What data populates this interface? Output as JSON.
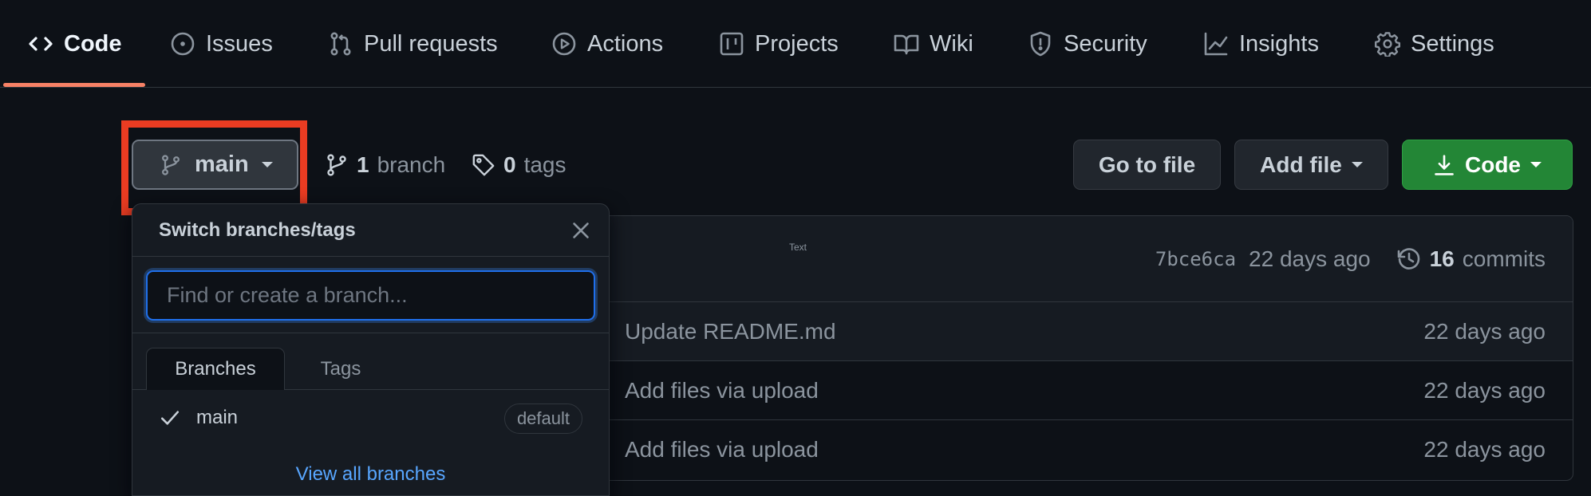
{
  "nav": {
    "tabs": [
      {
        "label": "Code",
        "icon": "code-icon",
        "selected": true
      },
      {
        "label": "Issues",
        "icon": "issue-opened-icon"
      },
      {
        "label": "Pull requests",
        "icon": "git-pull-request-icon"
      },
      {
        "label": "Actions",
        "icon": "play-icon"
      },
      {
        "label": "Projects",
        "icon": "table-icon"
      },
      {
        "label": "Wiki",
        "icon": "book-icon"
      },
      {
        "label": "Security",
        "icon": "shield-icon"
      },
      {
        "label": "Insights",
        "icon": "graph-icon"
      },
      {
        "label": "Settings",
        "icon": "gear-icon"
      }
    ],
    "accent_color": "#f78166"
  },
  "branch_bar": {
    "current_branch": "main",
    "branch_count": "1",
    "branch_word": "branch",
    "tag_count": "0",
    "tag_word": "tags",
    "goto_file": "Go to file",
    "add_file": "Add file",
    "code": "Code",
    "highlight_color": "#ea3c22",
    "code_button_color": "#238636"
  },
  "dropdown": {
    "title": "Switch branches/tags",
    "search_placeholder": "Find or create a branch...",
    "tabs": [
      "Branches",
      "Tags"
    ],
    "branches": [
      {
        "name": "main",
        "badge": "default",
        "checked": true
      }
    ],
    "footer_link": "View all branches"
  },
  "repo": {
    "tiny_text": "Text",
    "commit_sha": "7bce6ca",
    "commit_time": "22 days ago",
    "commit_count": "16",
    "commit_word": "commits",
    "files": [
      {
        "message": "Update README.md",
        "time": "22 days ago"
      },
      {
        "message": "Add files via upload",
        "time": "22 days ago"
      },
      {
        "message": "Add files via upload",
        "time": "22 days ago"
      }
    ]
  }
}
